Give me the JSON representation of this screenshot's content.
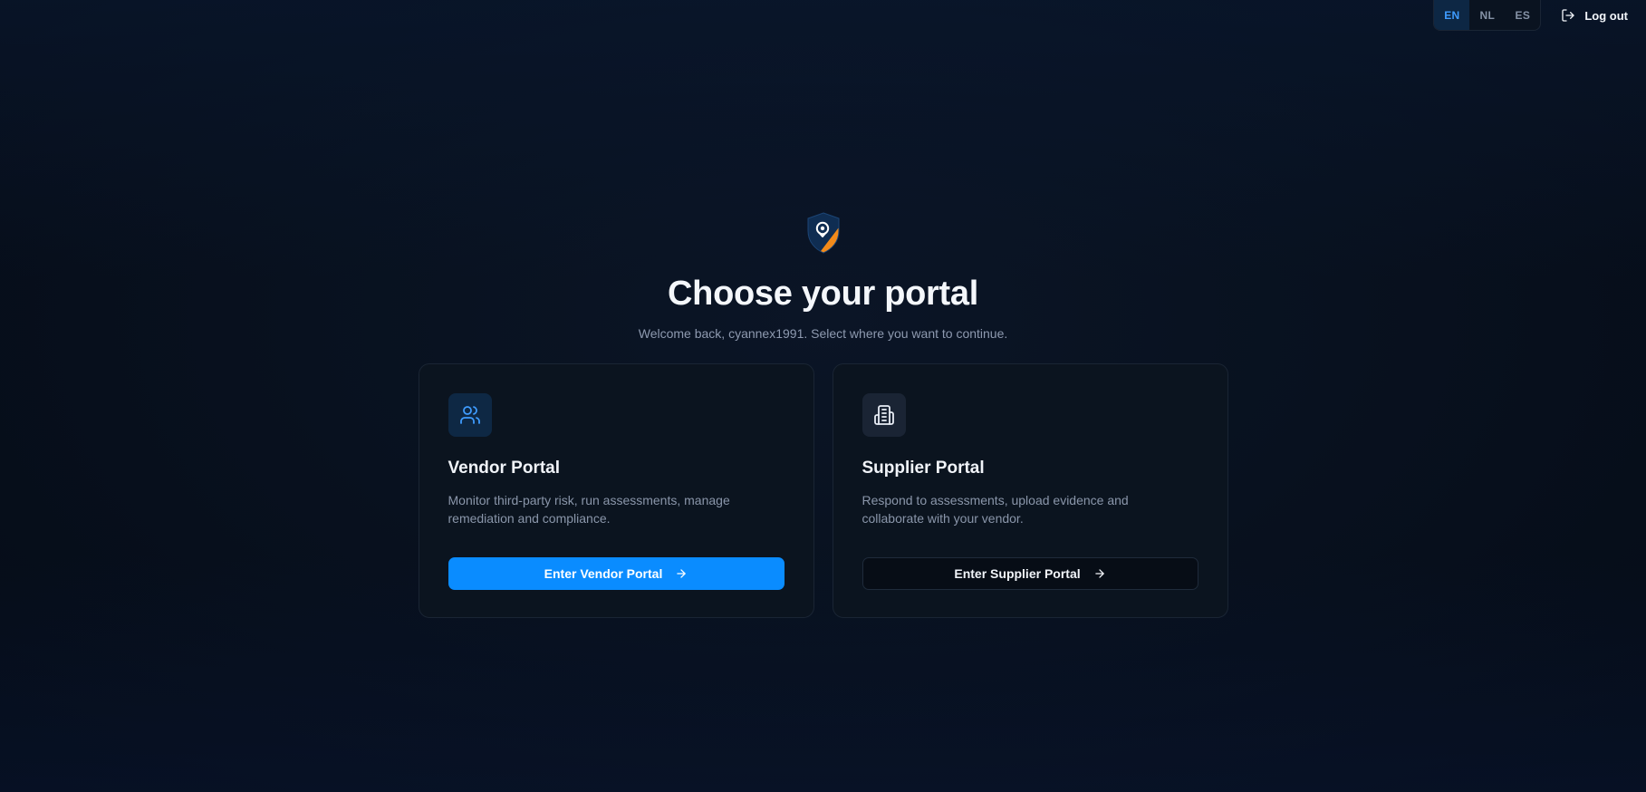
{
  "lang_switch": {
    "options": [
      "EN",
      "NL",
      "ES"
    ],
    "active": "EN"
  },
  "header": {
    "logout_label": "Log out"
  },
  "main": {
    "title": "Choose your portal",
    "subtitle": "Welcome back, cyannex1991. Select where you want to continue."
  },
  "cards": [
    {
      "title": "Vendor Portal",
      "description": "Monitor third-party risk, run assessments, manage remediation and compliance.",
      "button_label": "Enter Vendor Portal",
      "icon": "users-icon"
    },
    {
      "title": "Supplier Portal",
      "description": "Respond to assessments, upload evidence and collaborate with your vendor.",
      "button_label": "Enter Supplier Portal",
      "icon": "building-icon"
    }
  ],
  "colors": {
    "accent": "#0a8cff",
    "brand_orange": "#f28a1a",
    "brand_navy": "#0f2d52",
    "background": "#08111f",
    "card": "#0b141f"
  }
}
